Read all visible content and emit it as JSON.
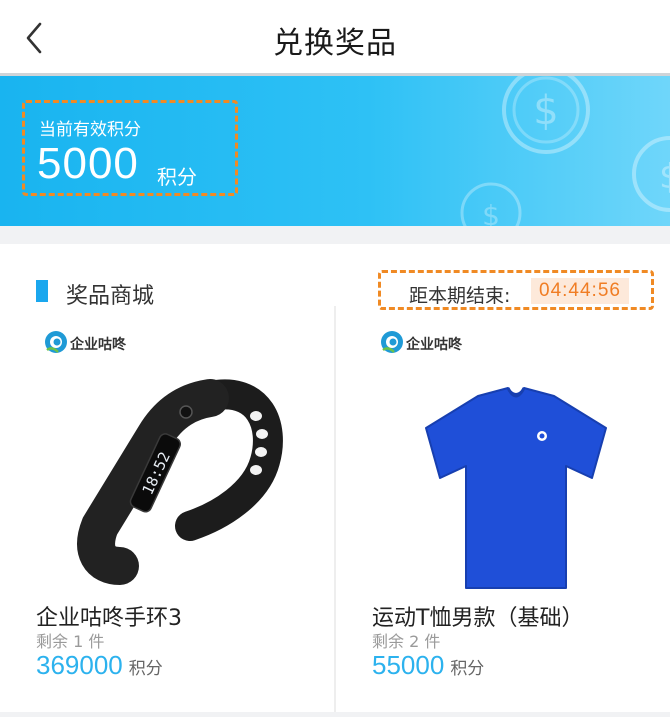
{
  "header": {
    "title": "兑换奖品",
    "back_icon": "chevron-left-icon"
  },
  "banner": {
    "points_label": "当前有效积分",
    "points_value": "5000",
    "points_unit": "积分",
    "decoration_icon": "coin-icon",
    "gradient_colors": [
      "#19b4f0",
      "#6fd6fa"
    ]
  },
  "section": {
    "title": "奖品商城",
    "countdown_label": "距本期结束:",
    "countdown_time": "04:44:56",
    "accent_color": "#1aa7ee",
    "highlight_color": "#f07d24"
  },
  "products": [
    {
      "brand": "企业咕咚",
      "name": "企业咕咚手环3",
      "stock": "剩余 1 件",
      "price": "369000",
      "price_unit": "积分",
      "image": "wristband-image",
      "band_screen_text": "18:52"
    },
    {
      "brand": "企业咕咚",
      "name": "运动T恤男款（基础）",
      "stock": "剩余 2 件",
      "price": "55000",
      "price_unit": "积分",
      "image": "blue-tshirt-image"
    }
  ]
}
